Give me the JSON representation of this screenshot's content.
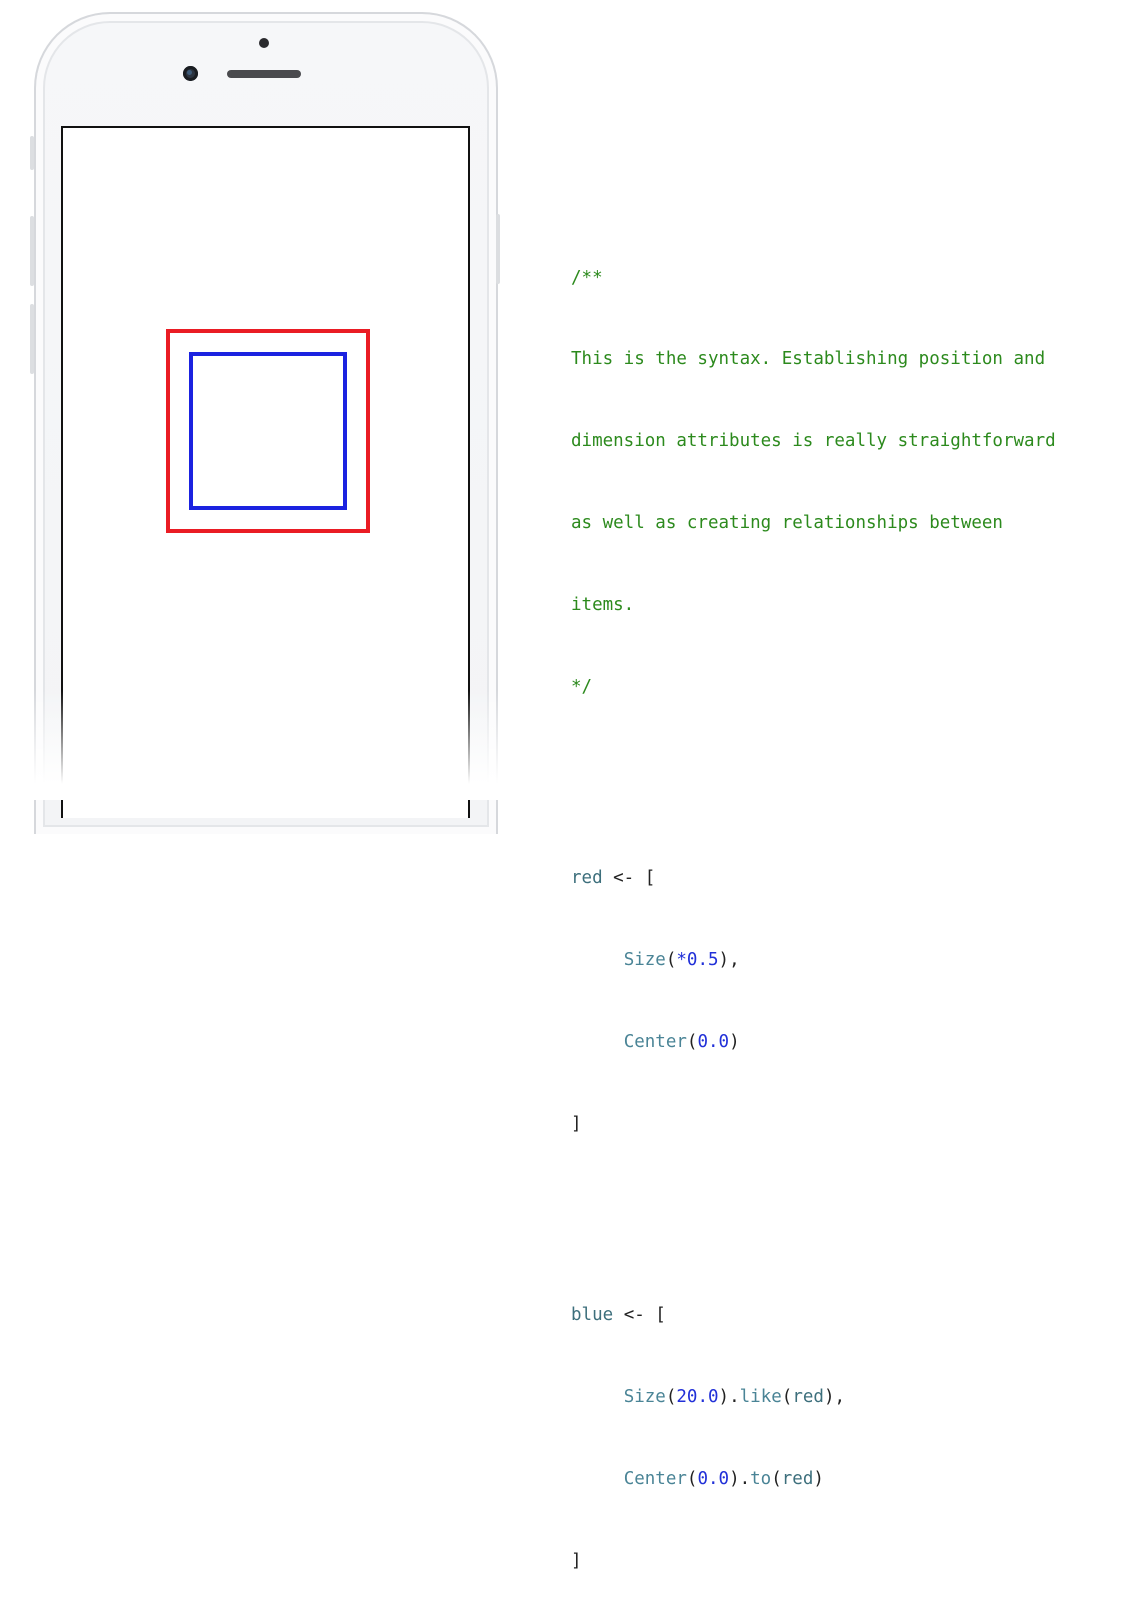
{
  "code": {
    "comment_open": "/**",
    "comment_lines": [
      "This is the syntax. Establishing position and",
      "dimension attributes is really straightforward",
      "as well as creating relationships between",
      "items."
    ],
    "comment_close": "*/",
    "red_block": {
      "name": "red",
      "arrow": " <- [",
      "size_fn": "Size",
      "size_arg": "*0.5",
      "center_fn": "Center",
      "center_arg": "0.0",
      "close": "]"
    },
    "blue_block": {
      "name": "blue",
      "arrow": " <- [",
      "size_fn": "Size",
      "size_arg": "20.0",
      "like_fn": "like",
      "like_arg": "red",
      "center_fn": "Center",
      "center_arg": "0.0",
      "to_fn": "to",
      "to_arg": "red",
      "close": "]"
    }
  },
  "colors": {
    "red_box": "#ea1c24",
    "blue_box": "#1b22e0",
    "comment": "#2c8a1d",
    "number": "#2130d8",
    "identifier": "#4a8496"
  }
}
